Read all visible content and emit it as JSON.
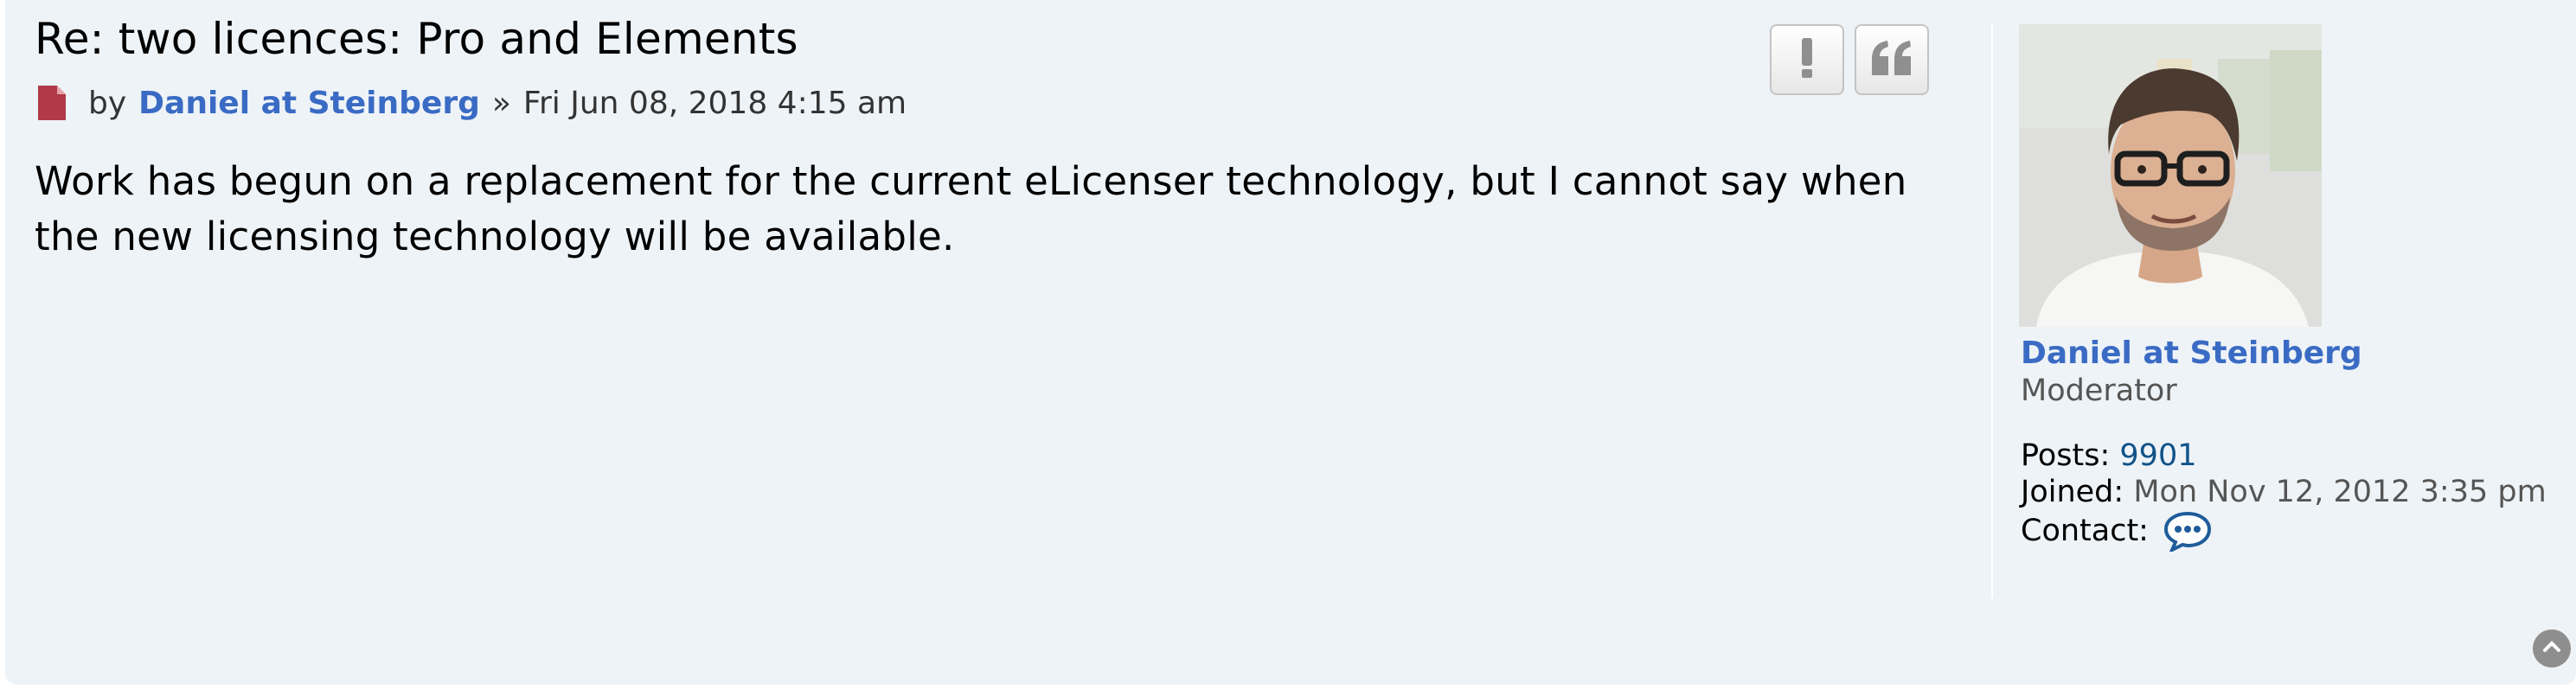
{
  "post": {
    "title": "Re: two licences: Pro and Elements",
    "byline": {
      "by_label": "by",
      "author": "Daniel at Steinberg",
      "separator": "»",
      "datetime": "Fri Jun 08, 2018 4:15 am"
    },
    "body": "Work has begun on a replacement for the current eLicenser technology, but I cannot say when the new licensing technology will be available.",
    "buttons": {
      "report_icon": "exclamation-icon",
      "quote_icon": "quote-icon"
    }
  },
  "profile": {
    "name": "Daniel at Steinberg",
    "rank": "Moderator",
    "posts_label": "Posts:",
    "posts_count": "9901",
    "joined_label": "Joined:",
    "joined_value": "Mon Nov 12, 2012 3:35 pm",
    "contact_label": "Contact:",
    "contact_icon": "speech-bubble-icon"
  },
  "colors": {
    "post_background": "#eef3f7",
    "link_blue": "#3a6bc4",
    "dark_link_blue": "#105289",
    "post_icon_red": "#b03a48"
  }
}
